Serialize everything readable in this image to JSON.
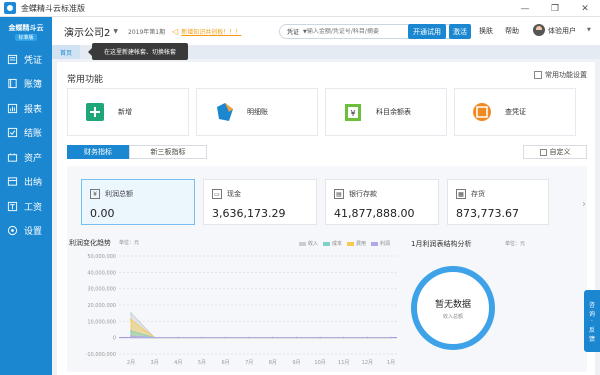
{
  "window": {
    "title": "金蝶精斗云标准版",
    "minimize": "—",
    "restore": "❐",
    "close": "✕"
  },
  "sidebar": {
    "brand": "金蝶精斗云",
    "brand_tag": "标准版",
    "items": [
      {
        "label": "凭证",
        "icon": "voucher-icon"
      },
      {
        "label": "账簿",
        "icon": "ledger-icon"
      },
      {
        "label": "报表",
        "icon": "report-icon"
      },
      {
        "label": "结账",
        "icon": "closing-icon"
      },
      {
        "label": "资产",
        "icon": "asset-icon"
      },
      {
        "label": "出纳",
        "icon": "cashier-icon"
      },
      {
        "label": "工资",
        "icon": "salary-icon"
      },
      {
        "label": "设置",
        "icon": "settings-icon"
      }
    ]
  },
  "header": {
    "company": "演示公司2",
    "period": "2019年第1期",
    "notice": "新增知识共创板！！！",
    "search_type": "凭证",
    "search_placeholder": "输入金额/凭证号/科目/摘要",
    "btn_open": "开通试用",
    "btn_activate": "激活",
    "link_switch": "换肤",
    "link_help": "帮助",
    "user": "体验用户"
  },
  "tabs": {
    "home": "首页"
  },
  "tooltip": "在这里新建帐套、切换帐套",
  "main": {
    "section_title": "常用功能",
    "settings_btn": "常用功能设置",
    "functions": [
      {
        "label": "新增",
        "icon": "add-icon"
      },
      {
        "label": "明细账",
        "icon": "tag-icon"
      },
      {
        "label": "科目余额表",
        "icon": "balance-sheet-icon"
      },
      {
        "label": "查凭证",
        "icon": "search-voucher-icon"
      }
    ],
    "seg_finance": "财务指标",
    "seg_neeq": "新三板指标",
    "custom_btn": "自定义",
    "metrics": [
      {
        "label": "利润总额",
        "value": "0.00"
      },
      {
        "label": "现金",
        "value": "3,636,173.29"
      },
      {
        "label": "银行存款",
        "value": "41,877,888.00"
      },
      {
        "label": "存货",
        "value": "873,773.67"
      }
    ],
    "chart_title": "利润变化趋势",
    "chart_unit": "单位：元",
    "pie_title": "1月利润表结构分析",
    "pie_unit": "单位：元",
    "pie_empty": "暂无数据",
    "pie_sub": "收入总额",
    "float_btn": [
      "咨",
      "询",
      "·",
      "反",
      "馈"
    ]
  },
  "chart_data": {
    "type": "area",
    "title": "利润变化趋势",
    "ylabel": "单位：元",
    "categories": [
      "2月",
      "3月",
      "4月",
      "5月",
      "6月",
      "7月",
      "8月",
      "9月",
      "10月",
      "11月",
      "12月",
      "1月"
    ],
    "yticks": [
      "50,000,000",
      "40,000,000",
      "30,000,000",
      "20,000,000",
      "10,000,000",
      "0",
      "-10,000,000"
    ],
    "ylim": [
      -10000000,
      50000000
    ],
    "grid": true,
    "legend_position": "top-right",
    "series": [
      {
        "name": "收入",
        "color": "#c9cdd3",
        "values": [
          15000000,
          0,
          0,
          0,
          0,
          0,
          0,
          0,
          0,
          0,
          0,
          0
        ]
      },
      {
        "name": "成本",
        "color": "#7fd1c4",
        "values": [
          4000000,
          0,
          0,
          0,
          0,
          0,
          0,
          0,
          0,
          0,
          0,
          0
        ]
      },
      {
        "name": "费用",
        "color": "#f6c94f",
        "values": [
          11000000,
          0,
          0,
          0,
          0,
          0,
          0,
          0,
          0,
          0,
          0,
          0
        ]
      },
      {
        "name": "利润",
        "color": "#b3a6ea",
        "values": [
          1000000,
          0,
          0,
          0,
          0,
          0,
          0,
          0,
          0,
          0,
          0,
          0
        ]
      }
    ]
  }
}
